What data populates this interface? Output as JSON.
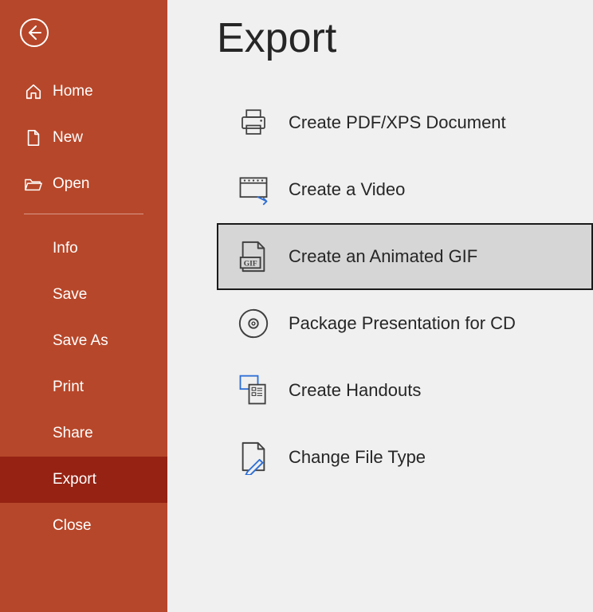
{
  "mainTitle": "Export",
  "sidebar": {
    "topItems": [
      {
        "label": "Home",
        "icon": "home"
      },
      {
        "label": "New",
        "icon": "page"
      },
      {
        "label": "Open",
        "icon": "folder"
      }
    ],
    "bottomItems": [
      {
        "label": "Info"
      },
      {
        "label": "Save"
      },
      {
        "label": "Save As"
      },
      {
        "label": "Print"
      },
      {
        "label": "Share"
      },
      {
        "label": "Export",
        "active": true
      },
      {
        "label": "Close"
      }
    ]
  },
  "exportOptions": [
    {
      "label": "Create PDF/XPS Document",
      "icon": "printer",
      "selected": false
    },
    {
      "label": "Create a Video",
      "icon": "video",
      "selected": false
    },
    {
      "label": "Create an Animated GIF",
      "icon": "gif",
      "selected": true
    },
    {
      "label": "Package Presentation for CD",
      "icon": "cd",
      "selected": false
    },
    {
      "label": "Create Handouts",
      "icon": "handouts",
      "selected": false
    },
    {
      "label": "Change File Type",
      "icon": "changefile",
      "selected": false
    }
  ]
}
